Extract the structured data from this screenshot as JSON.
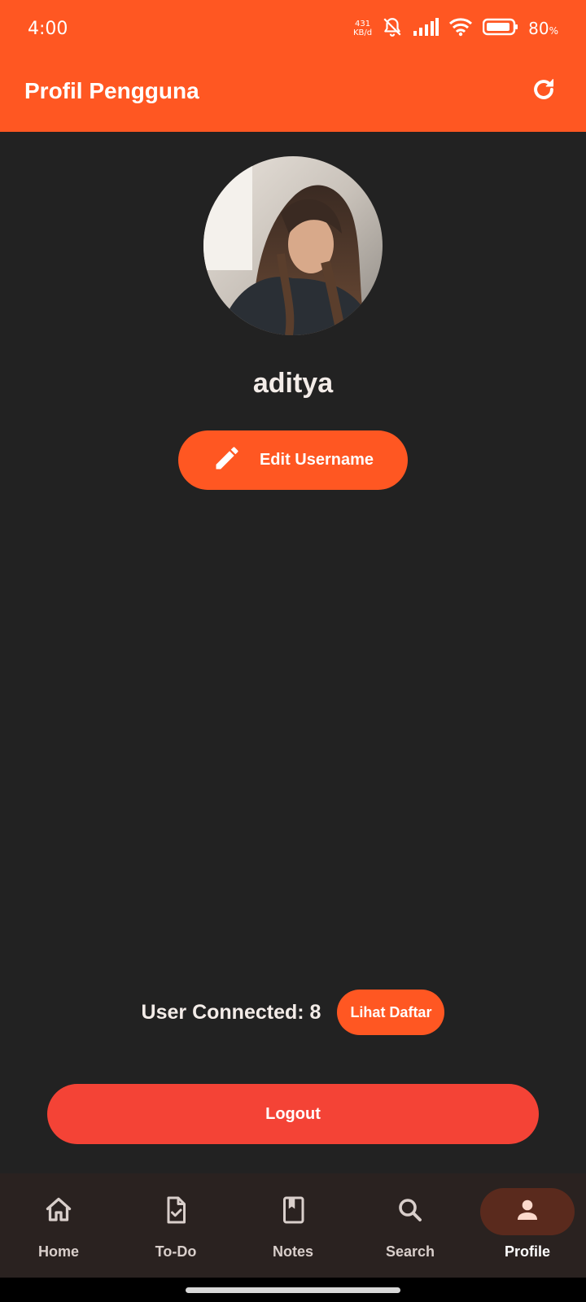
{
  "status": {
    "time": "4:00",
    "net_speed_value": "431",
    "net_speed_unit": "KB/d",
    "battery_percent": "80",
    "battery_unit": "%"
  },
  "appbar": {
    "title": "Profil Pengguna",
    "refresh_icon": "refresh-icon"
  },
  "profile": {
    "username": "aditya",
    "edit_button_label": "Edit Username",
    "edit_icon": "pencil-icon"
  },
  "connections": {
    "text": "User Connected: 8",
    "list_button_label": "Lihat Daftar"
  },
  "logout_label": "Logout",
  "nav": {
    "items": [
      {
        "label": "Home",
        "icon": "home-icon",
        "active": false
      },
      {
        "label": "To-Do",
        "icon": "todo-icon",
        "active": false
      },
      {
        "label": "Notes",
        "icon": "notes-icon",
        "active": false
      },
      {
        "label": "Search",
        "icon": "search-icon",
        "active": false
      },
      {
        "label": "Profile",
        "icon": "person-icon",
        "active": true
      }
    ]
  },
  "colors": {
    "accent": "#ff5722",
    "logout": "#f44336",
    "background": "#222222",
    "nav_background": "#2a2220",
    "nav_active_pill": "#5a2a1d"
  }
}
